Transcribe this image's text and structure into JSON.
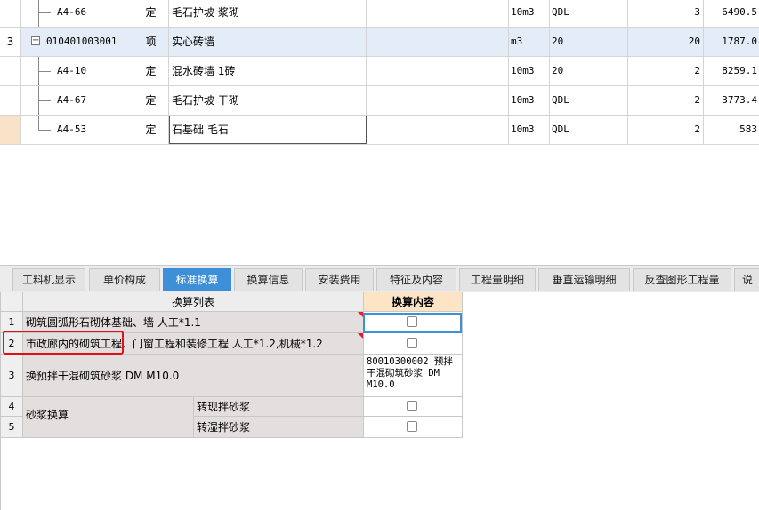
{
  "top_rows": [
    {
      "no": "",
      "code": "A4-66",
      "type": "定",
      "name": "毛石护坡 浆砌",
      "unit": "10m3",
      "expr": "QDL",
      "qty": "3",
      "price": "6490.5",
      "level": 1,
      "selected": false
    },
    {
      "no": "3",
      "code": "010401003001",
      "type": "项",
      "name": "实心砖墙",
      "unit": "m3",
      "expr": "20",
      "qty": "20",
      "price": "1787.0",
      "level": 0,
      "selected": true
    },
    {
      "no": "",
      "code": "A4-10",
      "type": "定",
      "name": "混水砖墙 1砖",
      "unit": "10m3",
      "expr": "20",
      "qty": "2",
      "price": "8259.1",
      "level": 1,
      "selected": false
    },
    {
      "no": "",
      "code": "A4-67",
      "type": "定",
      "name": "毛石护坡 干砌",
      "unit": "10m3",
      "expr": "QDL",
      "qty": "2",
      "price": "3773.4",
      "level": 1,
      "selected": false
    },
    {
      "no": "",
      "code": "A4-53",
      "type": "定",
      "name": "石基础 毛石",
      "unit": "10m3",
      "expr": "QDL",
      "qty": "2",
      "price": "583",
      "level": 1,
      "selected": false
    }
  ],
  "expander_symbol": "−",
  "tabs": [
    "工料机显示",
    "单价构成",
    "标准换算",
    "换算信息",
    "安装费用",
    "特征及内容",
    "工程量明细",
    "垂直运输明细",
    "反查图形工程量",
    "说"
  ],
  "active_tab": 2,
  "lower": {
    "header_list": "换算列表",
    "header_content": "换算内容",
    "rows": [
      {
        "no": "1",
        "text": "砌筑圆弧形石砌体基础、墙 人工*1.1"
      },
      {
        "no": "2",
        "text": "市政廊内的砌筑工程、门窗工程和装修工程 人工*1.2,机械*1.2"
      },
      {
        "no": "3",
        "text": "换预拌干混砌筑砂浆 DM M10.0",
        "content": "80010300002  预拌干混砌筑砂浆 DM M10.0"
      },
      {
        "no": "4",
        "group": "砂浆换算",
        "sub": "转现拌砂浆"
      },
      {
        "no": "5",
        "sub": "转湿拌砂浆"
      }
    ]
  }
}
